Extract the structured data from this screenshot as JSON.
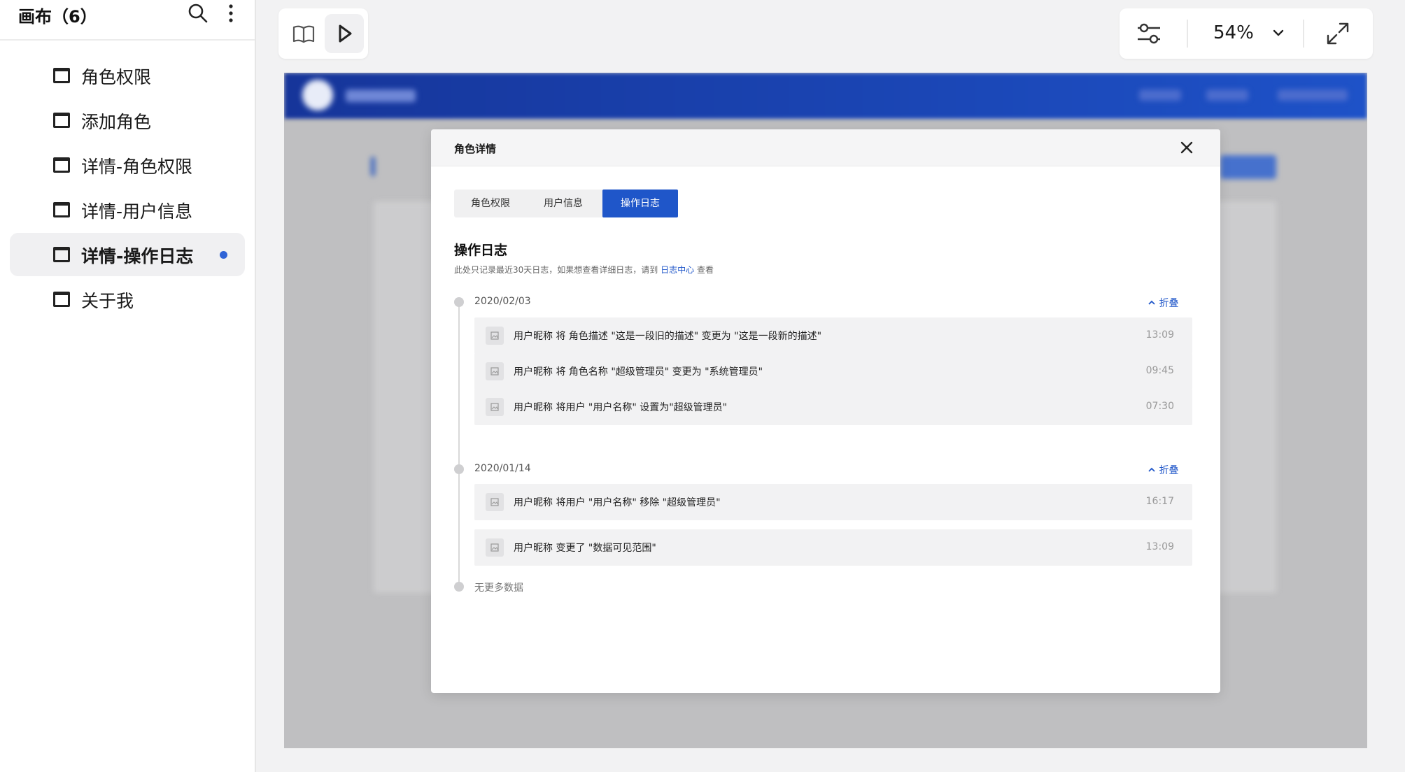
{
  "sidebar": {
    "title": "画布（6）",
    "items": [
      {
        "label": "角色权限",
        "active": false
      },
      {
        "label": "添加角色",
        "active": false
      },
      {
        "label": "详情-角色权限",
        "active": false
      },
      {
        "label": "详情-用户信息",
        "active": false
      },
      {
        "label": "详情-操作日志",
        "active": true
      },
      {
        "label": "关于我",
        "active": false
      }
    ]
  },
  "toolbar": {
    "zoom": "54%",
    "icons": [
      "book-icon",
      "play-icon",
      "sliders-icon",
      "chevron-down-icon",
      "fullscreen-icon"
    ]
  },
  "modal": {
    "title": "角色详情",
    "tabs": [
      "角色权限",
      "用户信息",
      "操作日志"
    ],
    "active_tab": "操作日志",
    "section_title": "操作日志",
    "description_before": "此处只记录最近30天日志，如果想查看详细日志，请到",
    "description_link": "日志中心",
    "description_after": "查看",
    "collapse_label": "折叠",
    "groups": [
      {
        "date": "2020/02/03",
        "entries": [
          {
            "text": "用户昵称 将 角色描述 \"这是一段旧的描述\" 变更为 \"这是一段新的描述\"",
            "time": "13:09"
          },
          {
            "text": "用户昵称 将 角色名称 \"超级管理员\" 变更为 \"系统管理员\"",
            "time": "09:45"
          },
          {
            "text": "用户昵称 将用户 \"用户名称\" 设置为\"超级管理员\"",
            "time": "07:30"
          }
        ]
      },
      {
        "date": "2020/01/14",
        "entries": [
          {
            "text": "用户昵称 将用户 \"用户名称\" 移除 \"超级管理员\"",
            "time": "16:17"
          },
          {
            "text": "用户昵称  变更了 \"数据可见范围\"",
            "time": "13:09"
          }
        ]
      }
    ],
    "footer": "无更多数据"
  },
  "colors": {
    "accent": "#1f56c9",
    "header_gradient_start": "#16359a",
    "header_gradient_end": "#1e52c8",
    "active_dot": "#2f63d6"
  }
}
